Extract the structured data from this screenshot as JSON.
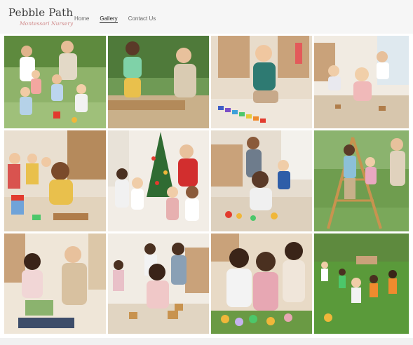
{
  "brand": {
    "name": "Pebble Path",
    "tagline": "Montessori Nursery"
  },
  "nav": {
    "items": [
      {
        "label": "Home"
      },
      {
        "label": "Gallery"
      },
      {
        "label": "Contact Us"
      }
    ],
    "active": "Gallery"
  },
  "gallery": {
    "photos": [
      {
        "subject": "teachers with children playing on grass"
      },
      {
        "subject": "girl and teacher sitting on wooden beam"
      },
      {
        "subject": "boy playing with colorful blocks"
      },
      {
        "subject": "toddlers on classroom rug"
      },
      {
        "subject": "children building wooden toys"
      },
      {
        "subject": "children around christmas tree"
      },
      {
        "subject": "boy playing with wooden toys"
      },
      {
        "subject": "children on wooden climbing frame"
      },
      {
        "subject": "girl reading book with teacher"
      },
      {
        "subject": "toddler with wooden blocks"
      },
      {
        "subject": "children with colorful eggs"
      },
      {
        "subject": "children playing football"
      }
    ]
  }
}
